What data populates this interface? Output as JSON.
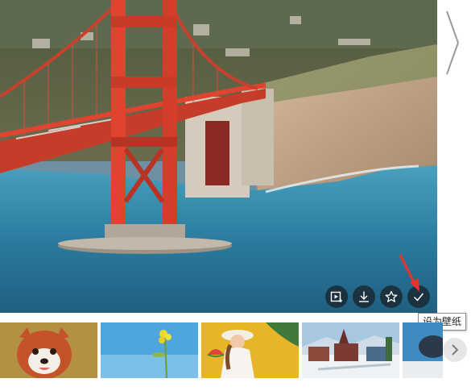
{
  "preview": {
    "subject": "golden-gate-bridge",
    "next_icon": "chevron-right-icon"
  },
  "actions": [
    {
      "name": "preview-play-button",
      "icon": "video-preview-icon"
    },
    {
      "name": "download-button",
      "icon": "download-icon"
    },
    {
      "name": "favorite-button",
      "icon": "star-icon"
    },
    {
      "name": "set-wallpaper-button",
      "icon": "check-icon"
    }
  ],
  "tooltip": {
    "set_wallpaper": "设为壁纸"
  },
  "thumbnails": [
    {
      "name": "thumb-red-panda"
    },
    {
      "name": "thumb-yellow-flower"
    },
    {
      "name": "thumb-woman-watermelon"
    },
    {
      "name": "thumb-snowy-town"
    },
    {
      "name": "thumb-partial"
    }
  ],
  "strip": {
    "next_icon": "chevron-right-icon"
  },
  "colors": {
    "bridge": "#e0442f",
    "sea": "#2c7ea0",
    "cliff": "#c9a98a",
    "button_bg": "#191e23",
    "pointer": "#e8322c"
  }
}
